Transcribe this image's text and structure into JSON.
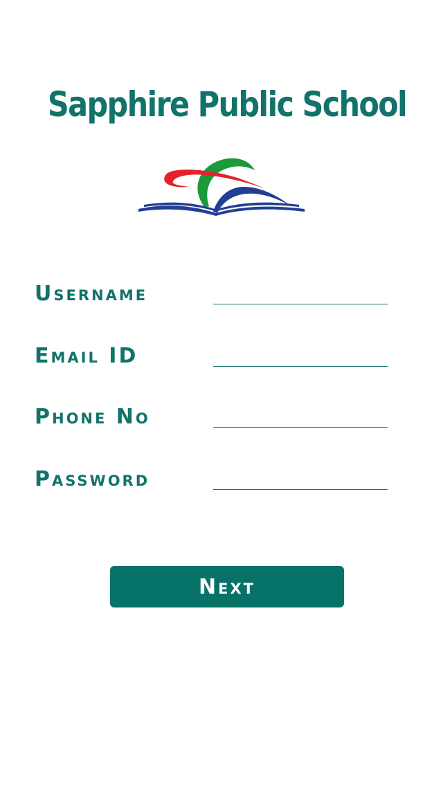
{
  "header": {
    "title": "Sapphire Public School",
    "logo_icon": "open-book-logo-icon"
  },
  "form": {
    "fields": [
      {
        "label": "Username",
        "value": "",
        "placeholder": ""
      },
      {
        "label": "Email ID",
        "value": "",
        "placeholder": ""
      },
      {
        "label": "Phone No",
        "value": "",
        "placeholder": ""
      },
      {
        "label": "Password",
        "value": "",
        "placeholder": ""
      }
    ],
    "submit_label": "Next"
  },
  "colors": {
    "primary": "#067268",
    "text_teal": "#11736a",
    "logo_red": "#e2232a",
    "logo_green": "#1a9a3a",
    "logo_blue": "#223f95",
    "background": "#ffffff"
  }
}
